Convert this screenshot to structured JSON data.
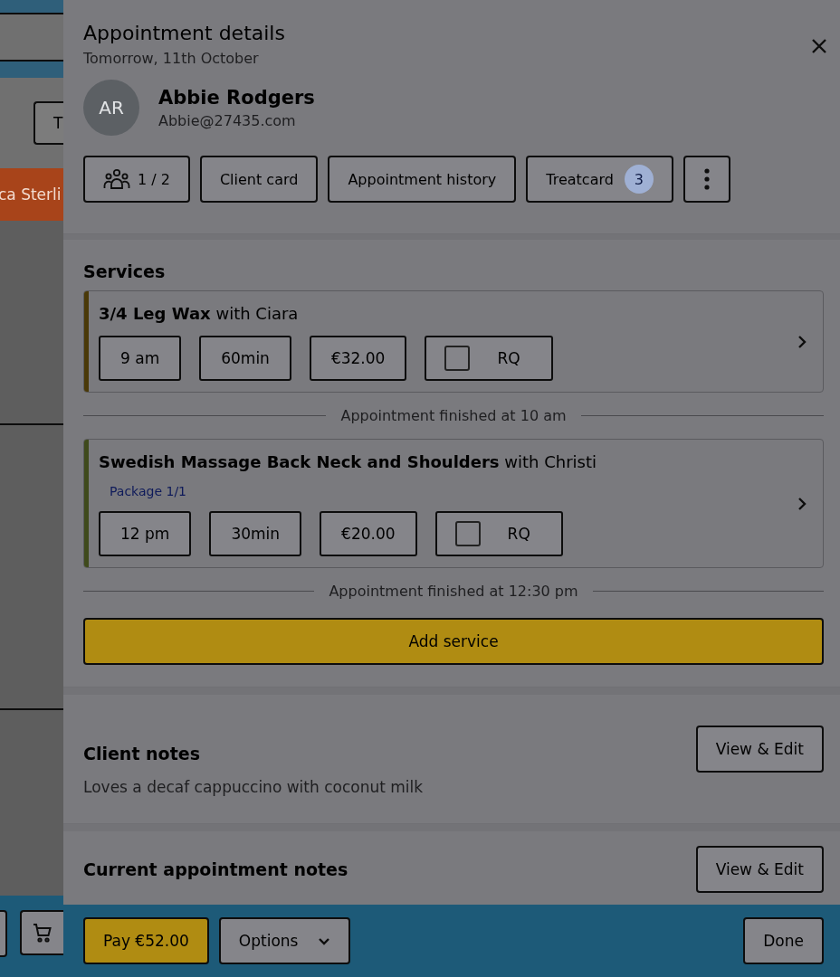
{
  "background": {
    "toolbar_button": "T",
    "booking_label": "ca Sterli"
  },
  "panel": {
    "title": "Appointment details",
    "subtitle": "Tomorrow, 11th October"
  },
  "client": {
    "initials": "AR",
    "name": "Abbie Rodgers",
    "email": "Abbie@27435.com"
  },
  "actions": [
    {
      "kind": "group",
      "label": "1 / 2"
    },
    {
      "kind": "plain",
      "label": "Client card"
    },
    {
      "kind": "plain",
      "label": "Appointment history"
    },
    {
      "kind": "badge",
      "label": "Treatcard",
      "badge": "3"
    },
    {
      "kind": "more"
    }
  ],
  "services": {
    "heading": "Services",
    "items": [
      {
        "title": "**3/4 Leg Wax** with Ciara",
        "color": "#4a3908",
        "time": "9 am",
        "duration": "60min",
        "price": "€32.00",
        "rq_label": "RQ",
        "rq_checked": false,
        "finished": "Appointment finished at 10 am"
      },
      {
        "title": "**Swedish Massage Back Neck and Shoulders** with Christi",
        "color": "#3f4a1c",
        "package": "Package 1/1",
        "time": "12 pm",
        "duration": "30min",
        "price": "€20.00",
        "rq_label": "RQ",
        "rq_checked": false,
        "finished": "Appointment finished at 12:30 pm"
      }
    ],
    "add_button": "Add service"
  },
  "client_notes": {
    "heading": "Client notes",
    "text": "Loves a decaf cappuccino with coconut milk",
    "button": "View & Edit"
  },
  "current_notes": {
    "heading": "Current appointment notes",
    "button": "View & Edit"
  },
  "footer": {
    "pay": "Pay €52.00",
    "options": "Options",
    "done": "Done"
  }
}
